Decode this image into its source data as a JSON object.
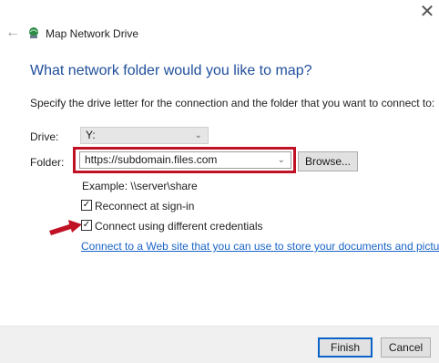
{
  "window": {
    "title": "Map Network Drive",
    "close_icon": "close-icon",
    "back_icon": "back-arrow-icon",
    "app_icon": "network-drive-icon"
  },
  "main": {
    "heading": "What network folder would you like to map?",
    "instruction": "Specify the drive letter for the connection and the folder that you want to connect to:",
    "drive": {
      "label": "Drive:",
      "value": "Y:"
    },
    "folder": {
      "label": "Folder:",
      "value": "https://subdomain.files.com",
      "browse_label": "Browse..."
    },
    "example": "Example: \\\\server\\share",
    "reconnect": {
      "label": "Reconnect at sign-in",
      "checked": true
    },
    "different_credentials": {
      "label": "Connect using different credentials",
      "checked": true
    },
    "link": "Connect to a Web site that you can use to store your documents and pictures."
  },
  "footer": {
    "finish_label": "Finish",
    "cancel_label": "Cancel"
  },
  "colors": {
    "heading": "#1f4e9b",
    "highlight": "#c01224",
    "link": "#1a64c8",
    "accent_button_border": "#0a64c8"
  }
}
